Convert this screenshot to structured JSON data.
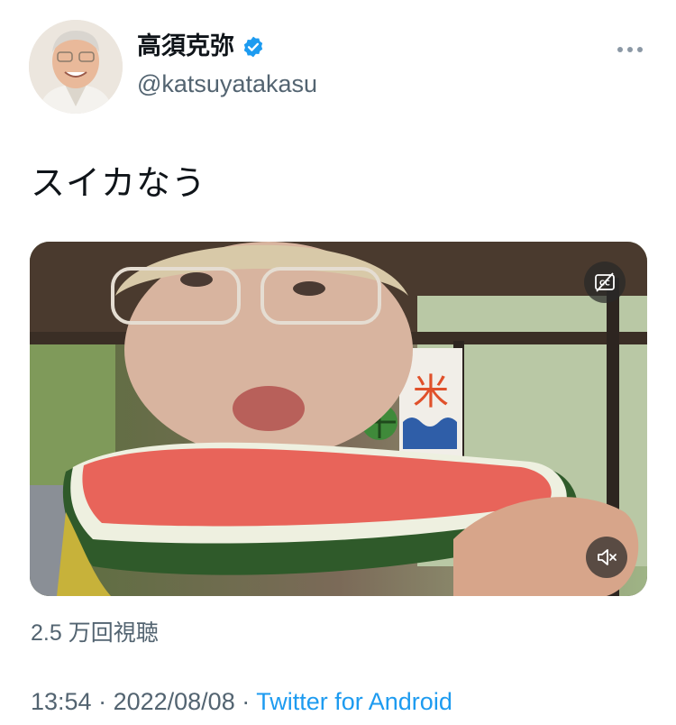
{
  "user": {
    "display_name": "高須克弥",
    "handle": "@katsuyatakasu",
    "verified": true
  },
  "tweet": {
    "text": "スイカなう"
  },
  "video": {
    "views": "2.5 万回視聴"
  },
  "meta": {
    "time": "13:54",
    "sep1": " · ",
    "date": "2022/08/08",
    "sep2": " · ",
    "source": "Twitter for Android"
  },
  "icons": {
    "more": "more-horizontal-icon",
    "verified": "verified-badge-icon",
    "captions": "captions-off-icon",
    "mute": "volume-muted-icon"
  },
  "colors": {
    "accent": "#1d9bf0",
    "secondary_text": "#536471"
  }
}
